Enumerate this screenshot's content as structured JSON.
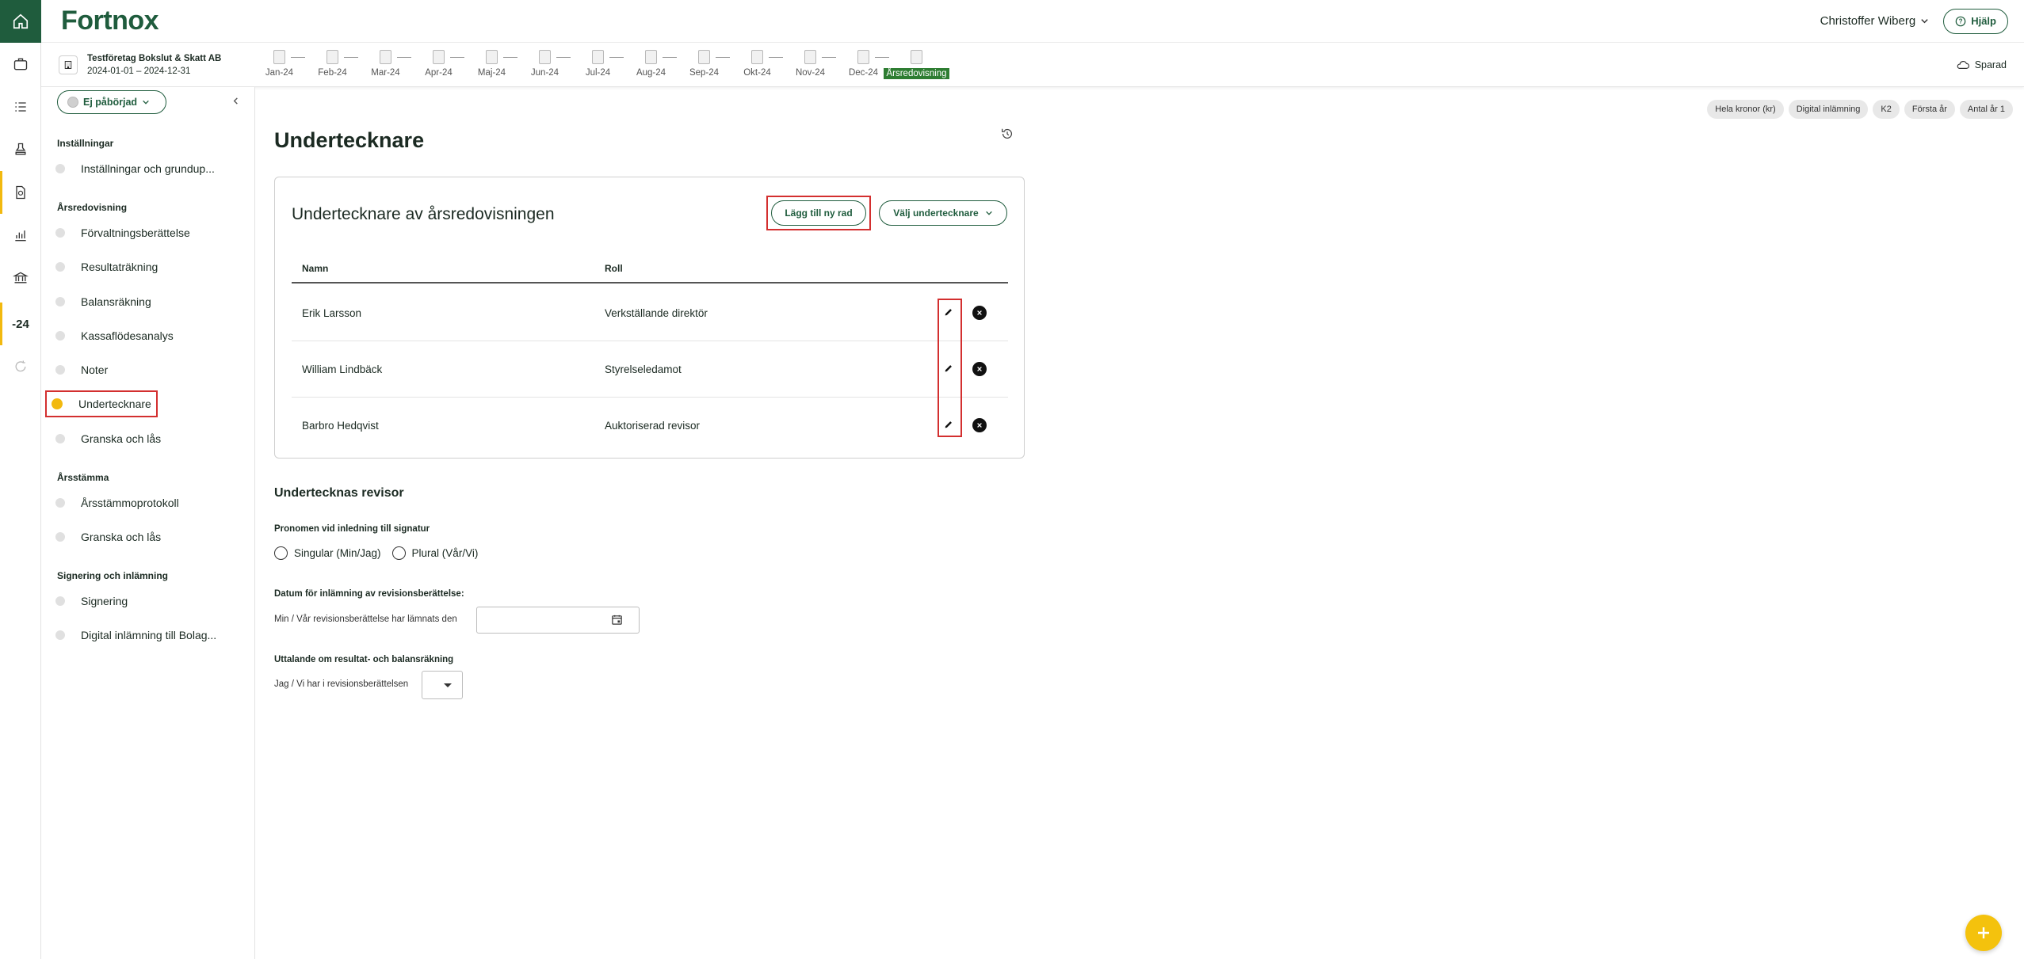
{
  "app": {
    "logo": "Fortnox"
  },
  "header": {
    "user_name": "Christoffer Wiberg",
    "help_label": "Hjälp"
  },
  "company": {
    "name": "Testföretag Bokslut & Skatt AB",
    "period": "2024-01-01 – 2024-12-31"
  },
  "rail": {
    "year_label": "-24"
  },
  "months": [
    "Jan-24",
    "Feb-24",
    "Mar-24",
    "Apr-24",
    "Maj-24",
    "Jun-24",
    "Jul-24",
    "Aug-24",
    "Sep-24",
    "Okt-24",
    "Nov-24",
    "Dec-24",
    "Årsredovisning"
  ],
  "saved_label": "Sparad",
  "sidenav": {
    "status": "Ej påbörjad",
    "sections": [
      {
        "title": "Inställningar",
        "items": [
          "Inställningar och grundup..."
        ]
      },
      {
        "title": "Årsredovisning",
        "items": [
          "Förvaltningsberättelse",
          "Resultaträkning",
          "Balansräkning",
          "Kassaflödesanalys",
          "Noter",
          "Undertecknare",
          "Granska och lås"
        ]
      },
      {
        "title": "Årsstämma",
        "items": [
          "Årsstämmoprotokoll",
          "Granska och lås"
        ]
      },
      {
        "title": "Signering och inlämning",
        "items": [
          "Signering",
          "Digital inlämning till Bolag..."
        ]
      }
    ],
    "active_item": "Undertecknare"
  },
  "tags": [
    "Hela kronor (kr)",
    "Digital inlämning",
    "K2",
    "Första år",
    "Antal år 1"
  ],
  "page_title": "Undertecknare",
  "card": {
    "title": "Undertecknare av årsredovisningen",
    "add_row_label": "Lägg till ny rad",
    "choose_label": "Välj undertecknare",
    "columns": {
      "name": "Namn",
      "role": "Roll"
    },
    "rows": [
      {
        "name": "Erik Larsson",
        "role": "Verkställande direktör"
      },
      {
        "name": "William Lindbäck",
        "role": "Styrelseledamot"
      },
      {
        "name": "Barbro Hedqvist",
        "role": "Auktoriserad revisor"
      }
    ]
  },
  "revisor": {
    "title": "Undertecknas revisor",
    "pronoun_label": "Pronomen vid inledning till signatur",
    "singular": "Singular (Min/Jag)",
    "plural": "Plural (Vår/Vi)",
    "date_label": "Datum för inlämning av revisionsberättelse:",
    "date_inline": "Min / Vår revisionsberättelse har lämnats den",
    "statement_label": "Uttalande om resultat- och balansräkning",
    "statement_inline": "Jag / Vi har i revisionsberättelsen"
  },
  "colors": {
    "brand": "#1f5c3d",
    "accent": "#f2b90f",
    "highlight": "#d32f2f"
  }
}
